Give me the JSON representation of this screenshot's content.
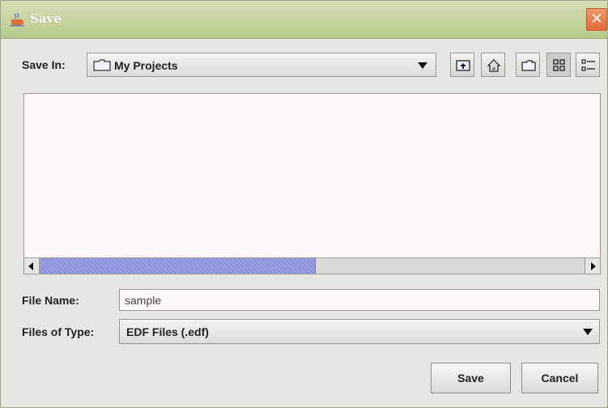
{
  "window": {
    "title": "Save",
    "close_glyph": "✕"
  },
  "save_in": {
    "label": "Save In:",
    "folder": "My Projects",
    "folder_icon": "folder-icon"
  },
  "toolbar": {
    "icons": [
      "up-one-level-icon",
      "home-icon",
      "new-folder-icon",
      "list-view-icon",
      "details-view-icon"
    ]
  },
  "file_name": {
    "label": "File Name:",
    "value": "sample"
  },
  "file_type": {
    "label": "Files of Type:",
    "selected": "EDF Files (.edf)"
  },
  "buttons": {
    "save": "Save",
    "cancel": "Cancel"
  },
  "colors": {
    "titlebar": "#c4d59e",
    "close": "#e8703f",
    "scroll_thumb": "#959ae2",
    "list_bg": "#fff8f8"
  }
}
